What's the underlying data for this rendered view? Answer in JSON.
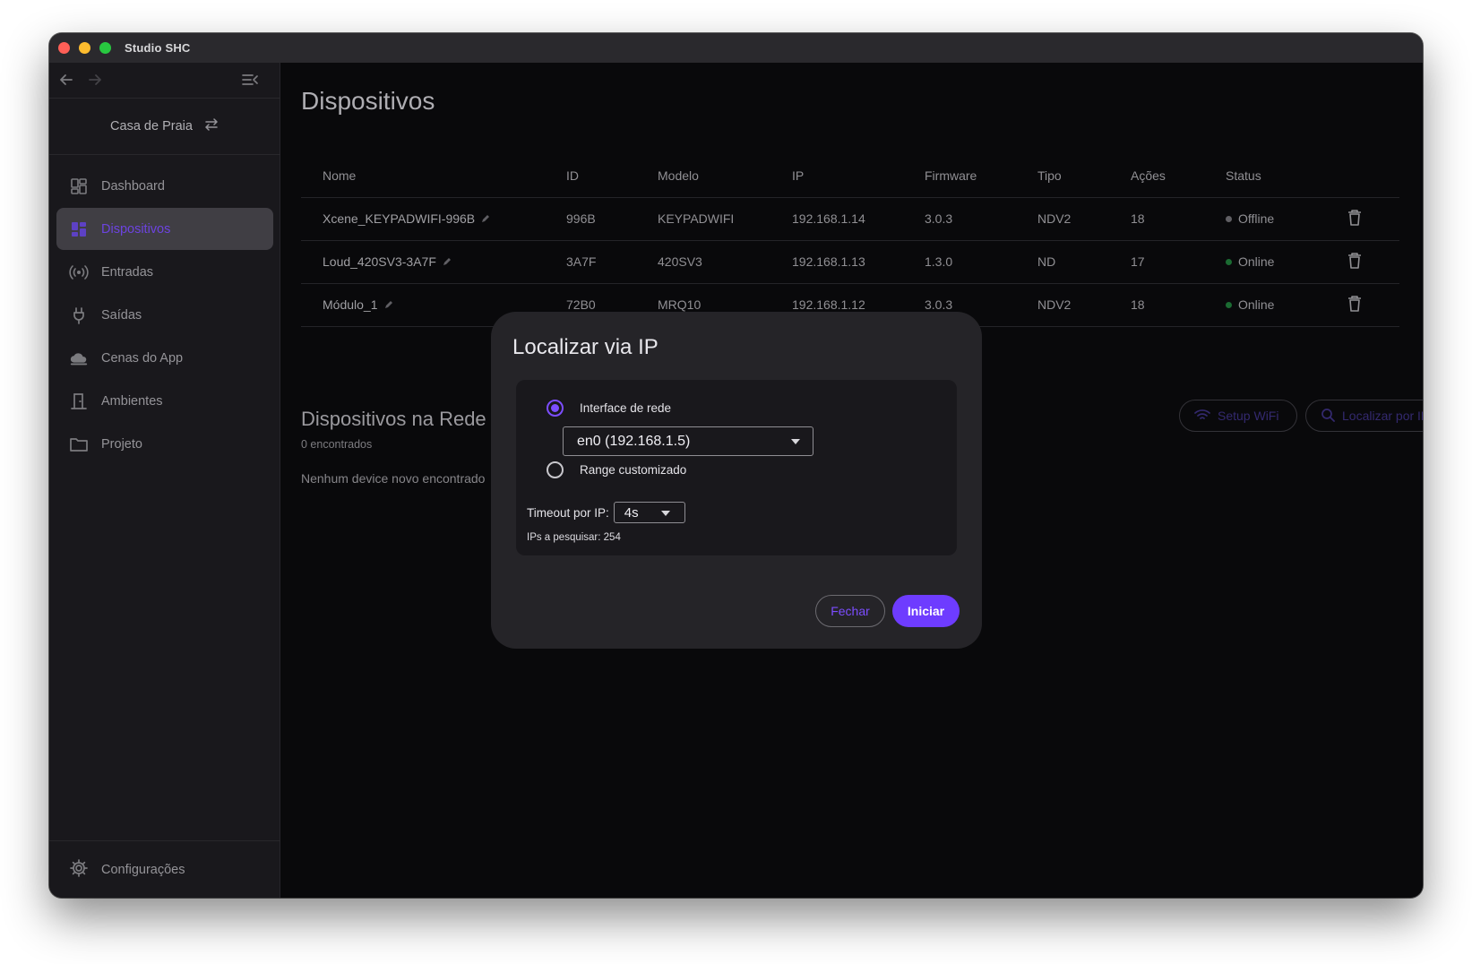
{
  "window": {
    "title": "Studio SHC"
  },
  "sidebar": {
    "project": "Casa de Praia",
    "items": [
      {
        "label": "Dashboard",
        "icon": "dashboard-icon",
        "active": false
      },
      {
        "label": "Dispositivos",
        "icon": "devices-icon",
        "active": true
      },
      {
        "label": "Entradas",
        "icon": "broadcast-icon",
        "active": false
      },
      {
        "label": "Saídas",
        "icon": "plug-icon",
        "active": false
      },
      {
        "label": "Cenas do App",
        "icon": "cloud-icon",
        "active": false
      },
      {
        "label": "Ambientes",
        "icon": "door-icon",
        "active": false
      },
      {
        "label": "Projeto",
        "icon": "folder-icon",
        "active": false
      }
    ],
    "footer": "Configurações"
  },
  "main": {
    "title": "Dispositivos",
    "table": {
      "headers": [
        "Nome",
        "ID",
        "Modelo",
        "IP",
        "Firmware",
        "Tipo",
        "Ações",
        "Status"
      ],
      "rows": [
        {
          "name": "Xcene_KEYPADWIFI-996B",
          "id": "996B",
          "model": "KEYPADWIFI",
          "ip": "192.168.1.14",
          "firmware": "3.0.3",
          "type": "NDV2",
          "actions": "18",
          "status": "Offline"
        },
        {
          "name": "Loud_420SV3-3A7F",
          "id": "3A7F",
          "model": "420SV3",
          "ip": "192.168.1.13",
          "firmware": "1.3.0",
          "type": "ND",
          "actions": "17",
          "status": "Online"
        },
        {
          "name": "Módulo_1",
          "id": "72B0",
          "model": "MRQ10",
          "ip": "192.168.1.12",
          "firmware": "3.0.3",
          "type": "NDV2",
          "actions": "18",
          "status": "Online"
        }
      ]
    },
    "network": {
      "title": "Dispositivos na Rede",
      "count": "0 encontrados",
      "empty": "Nenhum device novo encontrado",
      "setup_wifi": "Setup WiFi",
      "locate_ip": "Localizar por IP"
    }
  },
  "dialog": {
    "title": "Localizar via IP",
    "interface_label": "Interface de rede",
    "interface_value": "en0 (192.168.1.5)",
    "range_label": "Range customizado",
    "timeout_label": "Timeout por IP:",
    "timeout_value": "4s",
    "ips_count": "IPs a pesquisar: 254",
    "cancel": "Fechar",
    "start": "Iniciar"
  },
  "colors": {
    "accent": "#7c4dff",
    "online": "#1f7a3a",
    "offline": "#6e6d72"
  }
}
